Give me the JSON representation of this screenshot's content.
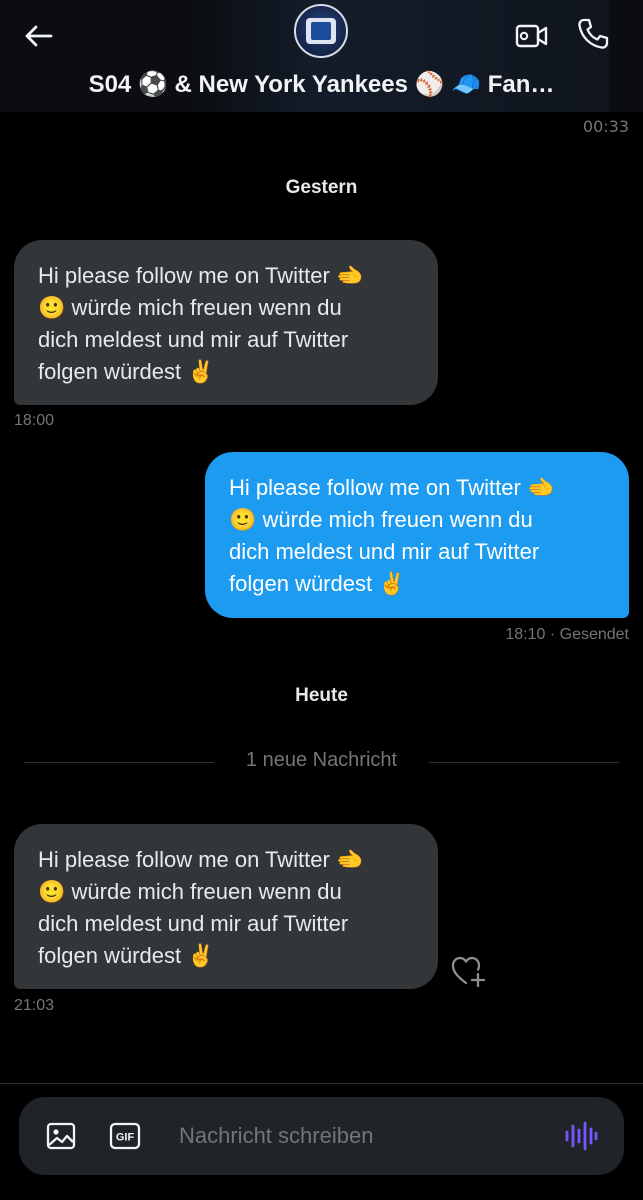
{
  "header": {
    "title": "S04 ⚽ & New York Yankees ⚾ 🧢 Fan…",
    "back_icon": "arrow-left-icon",
    "video_icon": "video-camera-icon",
    "call_icon": "phone-icon",
    "avatar": "group-avatar"
  },
  "conversation": {
    "top_timestamp": "00:33",
    "day_yesterday": "Gestern",
    "day_today": "Heute",
    "new_messages_label": "1 neue Nachricht",
    "messages": [
      {
        "direction": "incoming",
        "lines": [
          "Hi please follow me on Twitter 🫲",
          "🙂 würde mich freuen wenn du",
          "dich meldest und mir auf Twitter",
          "folgen würdest ✌️"
        ],
        "time": "18:00"
      },
      {
        "direction": "outgoing",
        "lines": [
          "Hi please follow me on Twitter 🫲",
          "🙂 würde mich freuen wenn du",
          "dich meldest und mir auf Twitter",
          "folgen würdest ✌️"
        ],
        "time": "18:10",
        "status": "· Gesendet"
      },
      {
        "direction": "incoming",
        "lines": [
          "Hi please follow me on Twitter 🫲",
          "🙂 würde mich freuen wenn du",
          "dich meldest und mir auf Twitter",
          "folgen würdest ✌️"
        ],
        "time": "21:03"
      }
    ]
  },
  "composer": {
    "placeholder": "Nachricht schreiben",
    "value": "",
    "gif_label": "GIF",
    "image_icon": "image-icon",
    "voice_icon": "voice-wave-icon",
    "react_icon": "heart-plus-icon"
  },
  "colors": {
    "background": "#000000",
    "incoming_bubble": "#333639",
    "outgoing_bubble": "#1d9bf0",
    "muted_text": "#71767b",
    "voice_accent": "#7856ff"
  }
}
